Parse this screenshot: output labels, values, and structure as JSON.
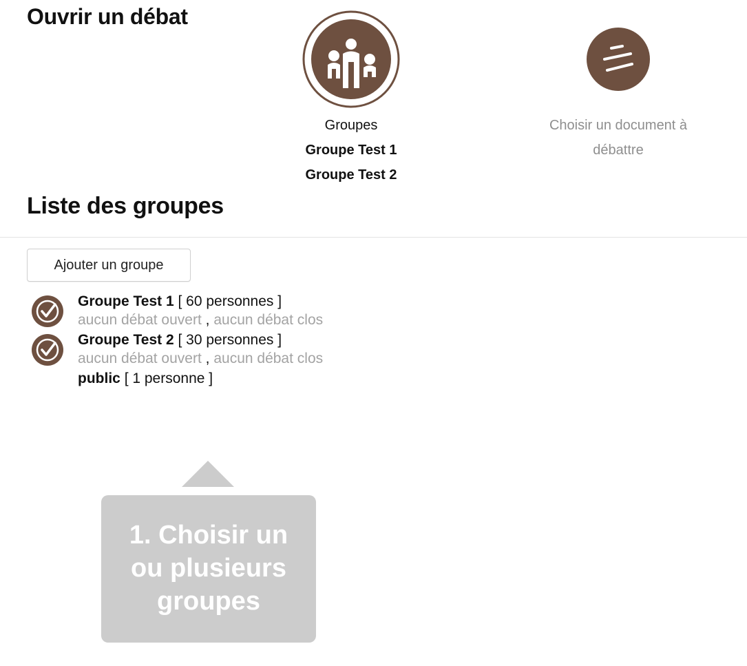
{
  "header": {
    "title": "Ouvrir un débat"
  },
  "steps": {
    "groups": {
      "icon": "people-circle-icon",
      "label": "Groupes",
      "selected": [
        "Groupe Test 1",
        "Groupe Test 2"
      ]
    },
    "document": {
      "icon": "document-lines-icon",
      "label_line1": "Choisir un document à",
      "label_line2": "débattre"
    }
  },
  "groups_section": {
    "title": "Liste des groupes",
    "add_button_label": "Ajouter un groupe",
    "groups": [
      {
        "name": "Groupe Test 1",
        "count": "[ 60 personnes ]",
        "open_debates": "aucun débat ouvert",
        "separator": ",",
        "closed_debates": "aucun débat clos",
        "selected": true
      },
      {
        "name": "Groupe Test 2",
        "count": "[ 30 personnes ]",
        "open_debates": "aucun débat ouvert",
        "separator": ",",
        "closed_debates": "aucun débat clos",
        "selected": true
      },
      {
        "name": "public",
        "count": "[ 1 personne ]",
        "selected": false
      }
    ]
  },
  "tooltip": {
    "line1": "1. Choisir un",
    "line2": "ou plusieurs",
    "line3": "groupes"
  },
  "colors": {
    "brand_brown": "#6e5040",
    "muted_text": "#a3a3a3",
    "tooltip_bg": "#cccccc"
  }
}
